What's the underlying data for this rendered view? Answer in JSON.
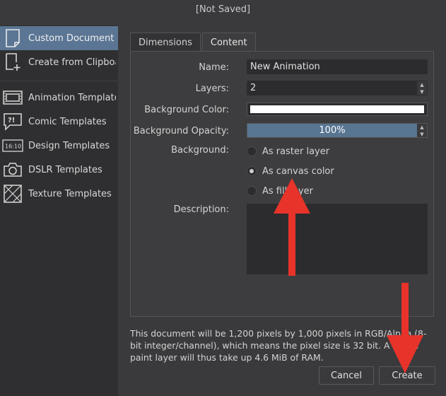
{
  "window": {
    "title": "[Not Saved]"
  },
  "sidebar": {
    "items": [
      {
        "label": "Custom Document",
        "icon": "document-icon",
        "active": true
      },
      {
        "label": "Create from Clipboard",
        "icon": "clipboard-icon",
        "active": false
      },
      {
        "label": "Animation Templates",
        "icon": "animation-icon",
        "active": false
      },
      {
        "label": "Comic Templates",
        "icon": "comic-icon",
        "active": false
      },
      {
        "label": "Design Templates",
        "icon": "design-icon",
        "active": false
      },
      {
        "label": "DSLR Templates",
        "icon": "camera-icon",
        "active": false
      },
      {
        "label": "Texture Templates",
        "icon": "texture-icon",
        "active": false
      }
    ],
    "design_icon_text": "16:10"
  },
  "tabs": [
    {
      "label": "Dimensions",
      "active": false
    },
    {
      "label": "Content",
      "active": true
    }
  ],
  "content": {
    "name_label": "Name:",
    "name_value": "New Animation",
    "layers_label": "Layers:",
    "layers_value": "2",
    "bg_color_label": "Background Color:",
    "bg_color_value": "#ffffff",
    "bg_opacity_label": "Background Opacity:",
    "bg_opacity_value": "100%",
    "bg_opacity_fraction": 1.0,
    "background_label": "Background:",
    "background_options": [
      {
        "label": "As raster layer",
        "checked": false
      },
      {
        "label": "As canvas color",
        "checked": true
      },
      {
        "label": "As fill layer",
        "checked": false
      }
    ],
    "description_label": "Description:",
    "description_value": ""
  },
  "info_text": "This document will be 1,200 pixels by 1,000 pixels in RGB/Alpha (8-bit integer/channel), which means the pixel size is 32 bit. A single paint layer will thus take up 4.6 MiB of RAM.",
  "buttons": {
    "cancel": "Cancel",
    "create": "Create"
  },
  "colors": {
    "accent": "#5b7694",
    "background": "#3a3a3c",
    "annotation_arrow": "#e8332a"
  }
}
